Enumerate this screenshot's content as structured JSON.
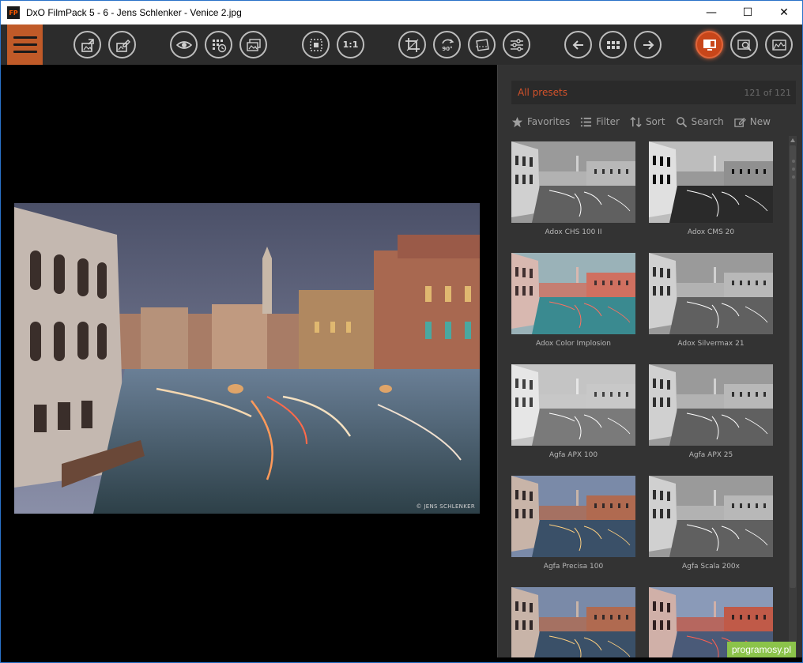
{
  "window": {
    "title": "DxO FilmPack 5 - 6 - Jens Schlenker - Venice 2.jpg",
    "app_icon_text": "FP",
    "controls": {
      "minimize": "—",
      "maximize": "☐",
      "close": "✕"
    }
  },
  "toolbar": {
    "buttons": [
      {
        "name": "export-button",
        "icon": "export-image-icon"
      },
      {
        "name": "export-edit-button",
        "icon": "edit-image-icon"
      },
      {
        "name": "preview-button",
        "icon": "eye-icon"
      },
      {
        "name": "history-button",
        "icon": "history-grid-icon"
      },
      {
        "name": "compare-button",
        "icon": "compare-images-icon"
      },
      {
        "name": "fit-button",
        "icon": "fit-screen-icon"
      },
      {
        "name": "zoom-100-button",
        "icon": "one-to-one-icon",
        "label": "1:1"
      },
      {
        "name": "crop-button",
        "icon": "crop-icon"
      },
      {
        "name": "rotate-button",
        "icon": "rotate-90-icon",
        "label": "90°"
      },
      {
        "name": "straighten-button",
        "icon": "straighten-icon"
      },
      {
        "name": "adjust-button",
        "icon": "sliders-icon"
      },
      {
        "name": "previous-button",
        "icon": "arrow-left-icon"
      },
      {
        "name": "browser-button",
        "icon": "grid-icon"
      },
      {
        "name": "next-button",
        "icon": "arrow-right-icon"
      },
      {
        "name": "presets-panel-button",
        "icon": "monitor-icon"
      },
      {
        "name": "loupe-button",
        "icon": "loupe-icon"
      },
      {
        "name": "histogram-button",
        "icon": "histogram-icon"
      }
    ]
  },
  "photo": {
    "credit": "© JENS SCHLENKER"
  },
  "panel": {
    "title": "All presets",
    "count": "121 of 121",
    "filters": [
      {
        "label": "Favorites",
        "icon": "star-icon"
      },
      {
        "label": "Filter",
        "icon": "list-icon"
      },
      {
        "label": "Sort",
        "icon": "sort-icon"
      },
      {
        "label": "Search",
        "icon": "search-icon"
      },
      {
        "label": "New",
        "icon": "new-preset-icon"
      }
    ],
    "presets": [
      {
        "label": "Adox CHS 100 II",
        "tone": "bw"
      },
      {
        "label": "Adox CMS 20",
        "tone": "bw-contrast"
      },
      {
        "label": "Adox Color Implosion",
        "tone": "color-cyan"
      },
      {
        "label": "Adox Silvermax 21",
        "tone": "bw"
      },
      {
        "label": "Agfa APX 100",
        "tone": "bw-light"
      },
      {
        "label": "Agfa APX 25",
        "tone": "bw"
      },
      {
        "label": "Agfa Precisa 100",
        "tone": "color"
      },
      {
        "label": "Agfa Scala 200x",
        "tone": "bw"
      },
      {
        "label": "",
        "tone": "color"
      },
      {
        "label": "",
        "tone": "color-warm"
      }
    ]
  },
  "watermark": "programosy.pl",
  "colors": {
    "accent": "#c8461a",
    "toolbar": "#2c2c2c",
    "panel": "#333333",
    "preset_title": "#d3522a"
  }
}
